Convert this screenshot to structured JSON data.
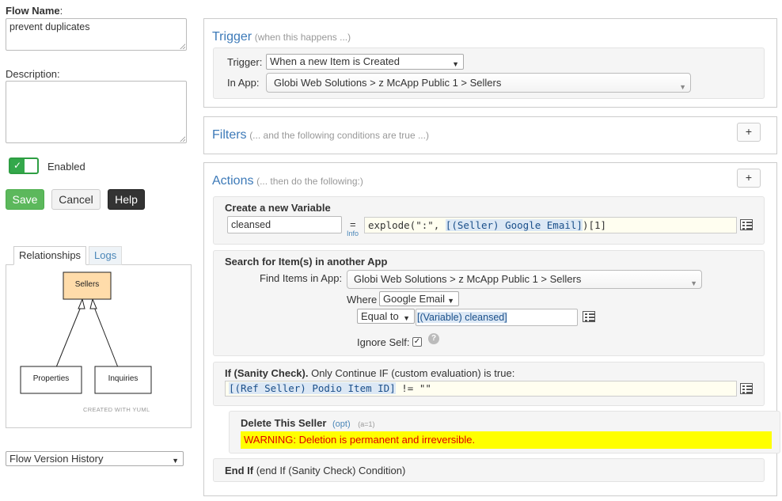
{
  "flow": {
    "name_label": "Flow Name",
    "name_colon": ":",
    "name_value": "prevent duplicates",
    "description_label": "Description:",
    "description_value": "",
    "enabled_label": "Enabled",
    "enabled_check": "✓"
  },
  "buttons": {
    "save": "Save",
    "cancel": "Cancel",
    "help": "Help"
  },
  "tabs": {
    "relationships": "Relationships",
    "logs": "Logs"
  },
  "graph": {
    "nodes": {
      "sellers": "Sellers",
      "properties": "Properties",
      "inquiries": "Inquiries"
    },
    "credit": "CREATED WITH YUML"
  },
  "version_history": {
    "selected": "Flow Version History"
  },
  "trigger": {
    "title": "Trigger",
    "subtitle": "(when this happens ...)",
    "trigger_label": "Trigger:",
    "trigger_value": "When a new Item is Created",
    "app_label": "In App:",
    "app_value": "Globi Web Solutions > z McApp Public 1 > Sellers"
  },
  "filters": {
    "title": "Filters",
    "subtitle": "(... and the following conditions are true ...)",
    "add": "+"
  },
  "actions": {
    "title": "Actions",
    "subtitle": "(... then do the following:)",
    "add": "+",
    "create_variable": {
      "heading": "Create a new Variable",
      "name_value": "cleansed",
      "equals": "=",
      "info": "Info",
      "expr_pre": "explode(\":\", ",
      "expr_token": "[(Seller) Google Email]",
      "expr_post": ")[1]"
    },
    "search": {
      "heading": "Search for Item(s) in another App",
      "find_label": "Find Items in App:",
      "find_value": "Globi Web Solutions > z McApp Public 1 > Sellers",
      "where_label": "Where",
      "where_field": "Google Email",
      "operator": "Equal to",
      "value_token": "[(Variable) cleansed]",
      "ignore_self_label": "Ignore Self:",
      "ignore_self_check": "✓",
      "help": "?"
    },
    "if_block": {
      "heading_bold": "If (Sanity Check).",
      "heading_rest": " Only Continue IF (custom evaluation) is true:",
      "expr_token": "[(Ref Seller) Podio Item ID]",
      "expr_post": " != \"\""
    },
    "delete": {
      "heading": "Delete This Seller",
      "opt": "(opt)",
      "meta": "(a=1)",
      "warning": "WARNING: Deletion is permanent and irreversible."
    },
    "end_if": {
      "bold": "End If",
      "rest": " (end If (Sanity Check) Condition)"
    }
  },
  "icons": {
    "caret": "▼",
    "plus": "+"
  }
}
